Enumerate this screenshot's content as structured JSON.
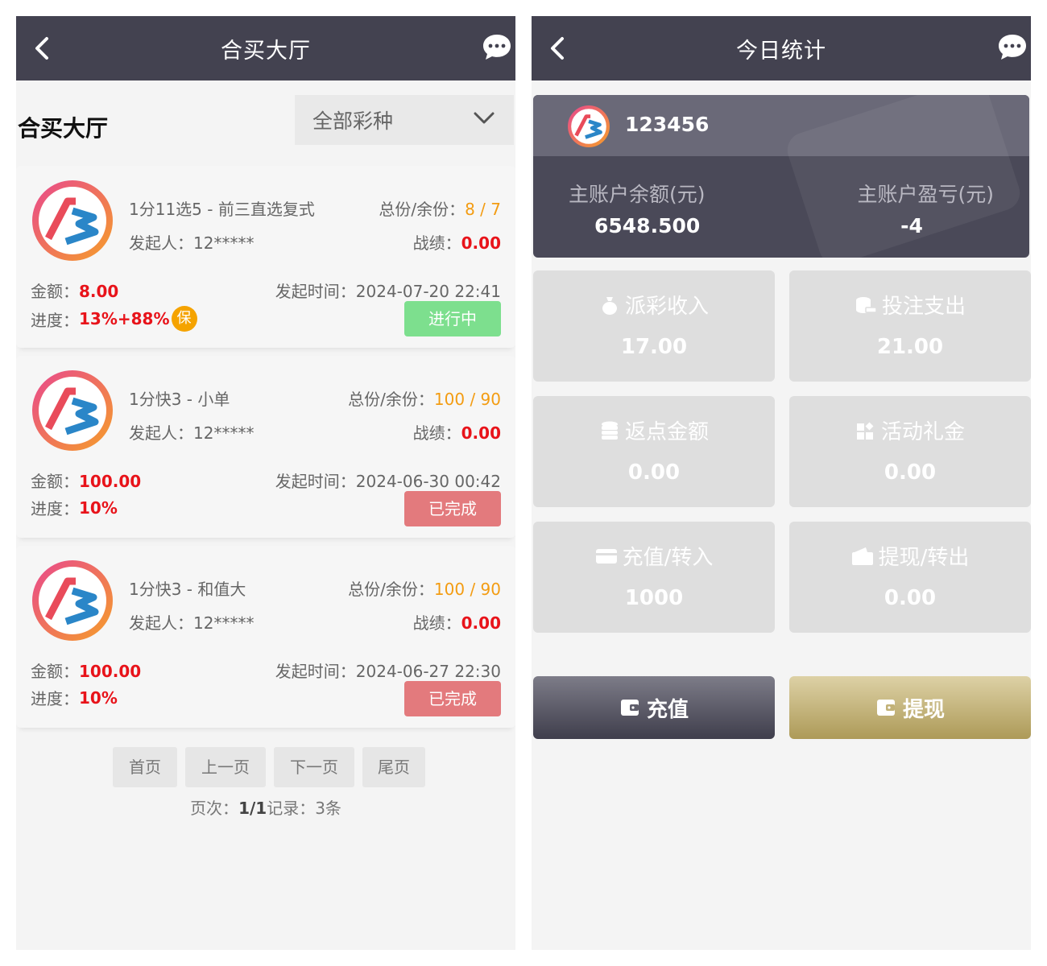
{
  "left": {
    "header": {
      "title": "合买大厅"
    },
    "hall_title": "合买大厅",
    "filter": {
      "selected": "全部彩种"
    },
    "cards": [
      {
        "name": "1分11选5 - 前三直选复式",
        "share_label": "总份/余份：",
        "share_value": "8 / 7",
        "starter_label": "发起人：",
        "starter": "12*****",
        "record_label": "战绩：",
        "record": "0.00",
        "amount_label": "金额：",
        "amount": "8.00",
        "time_label": "发起时间：",
        "time": "2024-07-20 22:41",
        "progress_label": "进度：",
        "progress": "13%+88%",
        "guarantee": "保",
        "status": "进行中",
        "status_color": "#7ddf8e"
      },
      {
        "name": "1分快3 - 小单",
        "share_label": "总份/余份：",
        "share_value": "100 / 90",
        "starter_label": "发起人：",
        "starter": "12*****",
        "record_label": "战绩：",
        "record": "0.00",
        "amount_label": "金额：",
        "amount": "100.00",
        "time_label": "发起时间：",
        "time": "2024-06-30 00:42",
        "progress_label": "进度：",
        "progress": "10%",
        "status": "已完成",
        "status_color": "#e37a7d"
      },
      {
        "name": "1分快3 - 和值大",
        "share_label": "总份/余份：",
        "share_value": "100 / 90",
        "starter_label": "发起人：",
        "starter": "12*****",
        "record_label": "战绩：",
        "record": "0.00",
        "amount_label": "金额：",
        "amount": "100.00",
        "time_label": "发起时间：",
        "time": "2024-06-27 22:30",
        "progress_label": "进度：",
        "progress": "10%",
        "status": "已完成",
        "status_color": "#e37a7d"
      }
    ],
    "pager": {
      "first": "首页",
      "prev": "上一页",
      "next": "下一页",
      "last": "尾页",
      "page_label": "页次：",
      "page": "1/1",
      "records_label": "记录：",
      "records": "3条"
    }
  },
  "right": {
    "header": {
      "title": "今日统计"
    },
    "account": {
      "username": "123456",
      "balance_label": "主账户余额(元)",
      "balance": "6548.500",
      "profit_label": "主账户盈亏(元)",
      "profit": "-4"
    },
    "tiles": [
      {
        "label": "派彩收入",
        "value": "17.00",
        "icon": "money-bag-icon"
      },
      {
        "label": "投注支出",
        "value": "21.00",
        "icon": "coins-icon"
      },
      {
        "label": "返点金额",
        "value": "0.00",
        "icon": "database-icon"
      },
      {
        "label": "活动礼金",
        "value": "0.00",
        "icon": "grid-gift-icon"
      },
      {
        "label": "充值/转入",
        "value": "1000",
        "icon": "card-icon"
      },
      {
        "label": "提现/转出",
        "value": "0.00",
        "icon": "wallet-icon"
      }
    ],
    "buttons": {
      "charge": "充值",
      "withdraw": "提现"
    }
  },
  "colors": {
    "header": "#434250",
    "progress_red": "#e8131a",
    "share_orange": "#f39c12",
    "running_green": "#7ddf8e",
    "done_red": "#e37a7d",
    "gold": "#c2b278"
  }
}
